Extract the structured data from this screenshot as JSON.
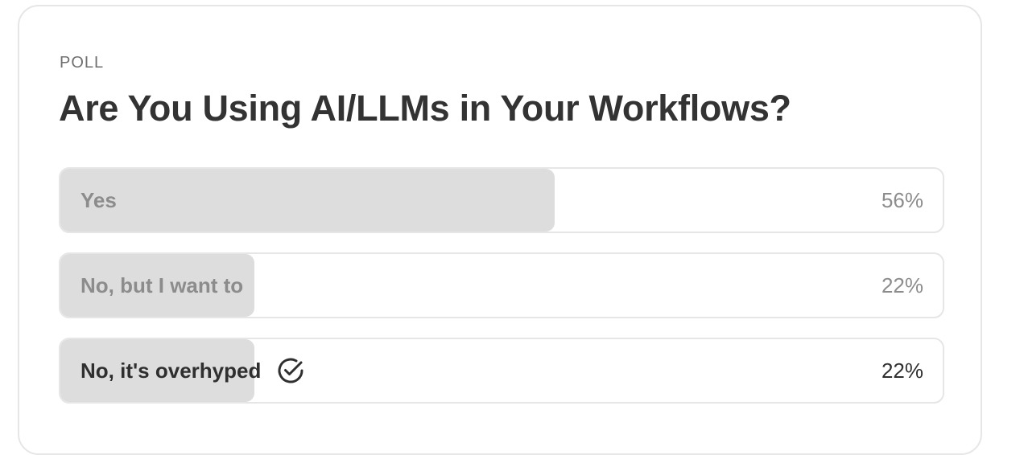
{
  "poll": {
    "eyebrow": "POLL",
    "title": "Are You Using AI/LLMs in Your Workflows?",
    "options": [
      {
        "label": "Yes",
        "percent_text": "56%",
        "percent": 56,
        "selected": false
      },
      {
        "label": "No, but I want to",
        "percent_text": "22%",
        "percent": 22,
        "selected": false
      },
      {
        "label": "No, it's overhyped",
        "percent_text": "22%",
        "percent": 22,
        "selected": true,
        "icon": "check-circle-icon"
      }
    ]
  },
  "colors": {
    "fill": "#dddddd",
    "border": "#e6e6e6",
    "text_muted": "#8c8c8c",
    "text_strong": "#2f2f2f"
  }
}
